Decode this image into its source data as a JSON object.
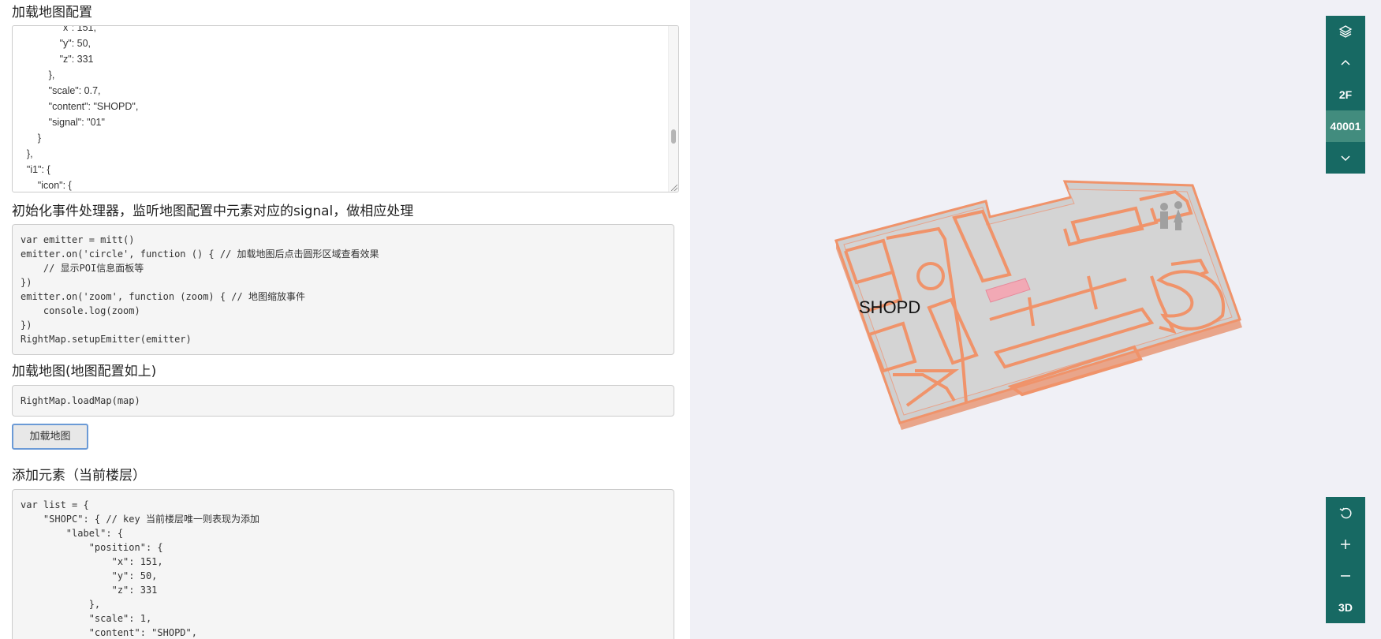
{
  "sections": {
    "map_config_title": "加载地图配置",
    "emitter_title": "初始化事件处理器，监听地图配置中元素对应的signal，做相应处理",
    "load_title": "加载地图(地图配置如上)",
    "add_title": "添加元素（当前楼层）"
  },
  "map_config_text": "                \"x\": 151,\n                \"y\": 50,\n                \"z\": 331\n            },\n            \"scale\": 0.7,\n            \"content\": \"SHOPD\",\n            \"signal\": \"01\"\n        }\n    },\n    \"i1\": {\n        \"icon\": {",
  "emitter_code": "var emitter = mitt()\nemitter.on('circle', function () { // 加载地图后点击圆形区域查看效果\n    // 显示POI信息面板等\n})\nemitter.on('zoom', function (zoom) { // 地图缩放事件\n    console.log(zoom)\n})\nRightMap.setupEmitter(emitter)",
  "load_code": "RightMap.loadMap(map)",
  "load_button": "加载地图",
  "add_code": "var list = {\n    \"SHOPC\": { // key 当前楼层唯一则表现为添加\n        \"label\": {\n            \"position\": {\n                \"x\": 151,\n                \"y\": 50,\n                \"z\": 331\n            },\n            \"scale\": 1,\n            \"content\": \"SHOPD\",",
  "map": {
    "shop_label": "SHOPD",
    "floor_controls": {
      "layers_icon": "layers-icon",
      "up_icon": "chevron-up-icon",
      "floor": "2F",
      "building_id": "40001",
      "down_icon": "chevron-down-icon"
    },
    "view_controls": {
      "reset_icon": "rotate-icon",
      "zoom_in_icon": "plus-icon",
      "zoom_out_icon": "minus-icon",
      "mode": "3D"
    },
    "colors": {
      "panel": "#176963",
      "active": "#428c7e",
      "wall": "#f0936a",
      "floor": "#d0d0d0",
      "background": "#f0f0f6"
    }
  }
}
